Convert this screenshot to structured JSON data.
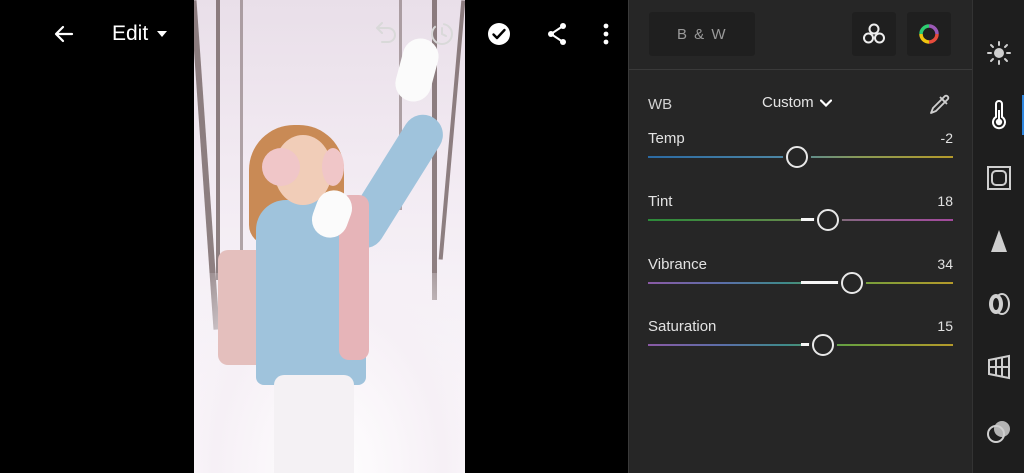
{
  "toolbar": {
    "edit_label": "Edit",
    "back_icon": "arrow-left-icon",
    "undo_icon": "undo-icon",
    "redo_icon": "redo-icon",
    "done_icon": "checkmark-circle-icon",
    "share_icon": "share-icon",
    "more_icon": "more-vertical-icon"
  },
  "panel": {
    "bw_label": "B & W",
    "profile_icon": "profiles-icon",
    "color_mix_icon": "color-mix-icon"
  },
  "white_balance": {
    "label": "WB",
    "preset": "Custom",
    "eyedropper_icon": "eyedropper-icon"
  },
  "sliders": {
    "temp": {
      "label": "Temp",
      "value": "-2",
      "position": 0.49
    },
    "tint": {
      "label": "Tint",
      "value": "18",
      "position": 0.59
    },
    "vibrance": {
      "label": "Vibrance",
      "value": "34",
      "position": 0.67
    },
    "saturation": {
      "label": "Saturation",
      "value": "15",
      "position": 0.575
    }
  },
  "rail": {
    "items": [
      "light-icon",
      "color-icon",
      "effects-icon",
      "detail-icon",
      "optics-icon",
      "geometry-icon",
      "masking-icon"
    ],
    "active": "color-icon"
  },
  "colors": {
    "accent": "#2d86e0",
    "panel_bg": "#262626",
    "rail_bg": "#1e1e1e"
  }
}
